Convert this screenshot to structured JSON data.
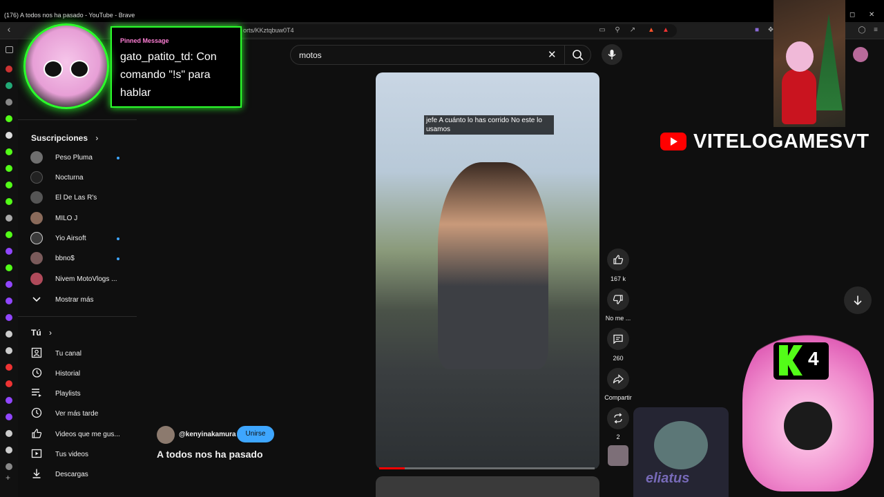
{
  "window": {
    "title": "(176) A todos nos ha pasado - YouTube - Brave"
  },
  "browser": {
    "url": "orts/KKztqbuw0T4"
  },
  "sidebar": {
    "subscriptions_title": "Suscripciones",
    "subscriptions": [
      {
        "name": "Peso Pluma",
        "new": true
      },
      {
        "name": "Nocturna",
        "new": false
      },
      {
        "name": "El De Las R's",
        "new": false
      },
      {
        "name": "MILO J",
        "new": false
      },
      {
        "name": "Yio Airsoft",
        "new": true
      },
      {
        "name": "bbno$",
        "new": true
      },
      {
        "name": "Nivem MotoVlogs ...",
        "new": false
      }
    ],
    "show_more": "Mostrar más",
    "you_title": "Tú",
    "you_items": [
      {
        "label": "Tu canal",
        "icon": "channel-icon"
      },
      {
        "label": "Historial",
        "icon": "history-icon"
      },
      {
        "label": "Playlists",
        "icon": "playlist-icon"
      },
      {
        "label": "Ver más tarde",
        "icon": "clock-icon"
      },
      {
        "label": "Videos que me gus...",
        "icon": "like-icon"
      },
      {
        "label": "Tus videos",
        "icon": "video-icon"
      },
      {
        "label": "Descargas",
        "icon": "download-icon"
      }
    ]
  },
  "search": {
    "query": "motos"
  },
  "short": {
    "caption": "jefe A cuánto lo has corrido No este lo usamos",
    "channel": "@kenyinakamura",
    "join_label": "Unirse",
    "title": "A todos nos ha pasado",
    "progress": 0.12,
    "actions": {
      "likes": "167 k",
      "dislike": "No me ...",
      "comments": "260",
      "share": "Compartir",
      "remix": "2"
    }
  },
  "overlay": {
    "pinned_header": "Pinned Message",
    "pinned_message": "gato_patito_td: Con comando \"!s\" para hablar",
    "brand": "VITELOGAMESVT",
    "kick_count": "4",
    "cam_name": "eliatus"
  },
  "colors": {
    "accent": "#3ea6ff",
    "youtube_red": "#ff0000",
    "overlay_green": "#2bff2b",
    "kick_green": "#53fc18"
  }
}
